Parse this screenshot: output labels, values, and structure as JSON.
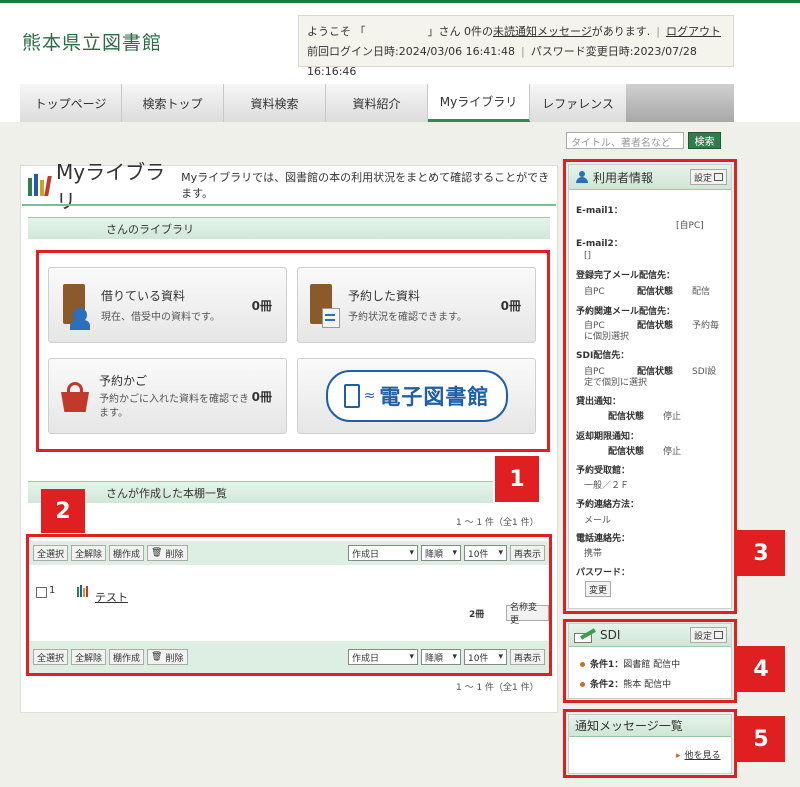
{
  "site": {
    "title": "熊本県立図書館"
  },
  "login": {
    "welcome_pre": "ようこそ 「",
    "welcome_mid": "」さん 0件の",
    "unread_link": "未読通知メッセージ",
    "welcome_post": "があります.",
    "logout": "ログアウト",
    "last_login": "前回ログイン日時:2024/03/06 16:41:48",
    "pw_change": "パスワード変更日時:2023/07/28 16:16:46"
  },
  "nav": {
    "tabs": [
      "トップページ",
      "検索トップ",
      "資料検索",
      "資料紹介",
      "Myライブラリ",
      "レファレンス"
    ],
    "active_index": 4
  },
  "search": {
    "placeholder": "タイトル、著者名など",
    "button": "検索"
  },
  "mylib": {
    "title": "Myライブラリ",
    "desc": "Myライブラリでは、図書館の本の利用状況をまとめて確認することができます。",
    "library_header": "さんのライブラリ",
    "cards": {
      "borrowed": {
        "title": "借りている資料",
        "sub": "現在、借受中の資料です。",
        "count": "0冊"
      },
      "reserved": {
        "title": "予約した資料",
        "sub": "予約状況を確認できます。",
        "count": "0冊"
      },
      "cart": {
        "title": "予約かご",
        "sub": "予約かごに入れた資料を確認できます。",
        "count": "0冊"
      },
      "ebook": {
        "label": "電子図書館"
      }
    },
    "shelf_header": "さんが作成した本棚一覧",
    "pager": "1 ～ 1 件（全1 件）",
    "toolbar": {
      "select_all": "全選択",
      "deselect_all": "全解除",
      "create": "棚作成",
      "delete": "削除",
      "sort": "作成日",
      "order": "降順",
      "per_page": "10件",
      "redisplay": "再表示"
    },
    "shelf_row": {
      "index": "1",
      "name": "テスト",
      "count": "2冊",
      "rename": "名称変更"
    }
  },
  "user_info": {
    "title": "利用者情報",
    "settings": "設定",
    "email1_label": "E-mail1：",
    "email1_val": "[自PC]",
    "email2_label": "E-mail2：",
    "email2_val": "[]",
    "reg_mail_label": "登録完了メール配信先：",
    "reg_mail_c1": "自PC",
    "reg_mail_c2": "配信状態",
    "reg_mail_c3": "配信",
    "res_mail_label": "予約関連メール配信先：",
    "res_mail_c1": "自PC",
    "res_mail_c2": "配信状態",
    "res_mail_c3": "予約毎",
    "res_mail_c4": "に個別選択",
    "sdi_label": "SDI配信先：",
    "sdi_c1": "自PC",
    "sdi_c2": "配信状態",
    "sdi_c3": "SDI設",
    "sdi_c4": "定で個別に選択",
    "loan_label": "貸出通知：",
    "loan_c1": "配信状態",
    "loan_c2": "停止",
    "due_label": "返却期限通知：",
    "due_c1": "配信状態",
    "due_c2": "停止",
    "pickup_label": "予約受取館：",
    "pickup_val": "一般／２Ｆ",
    "contact_label": "予約連絡方法：",
    "contact_val": "メール",
    "phone_label": "電話連絡先：",
    "phone_val": "携帯",
    "pw_label": "パスワード：",
    "pw_btn": "変更"
  },
  "sdi": {
    "title": "SDI",
    "settings": "設定",
    "c1_label": "条件1：",
    "c1_val": "図書館 配信中",
    "c2_label": "条件2：",
    "c2_val": "熊本 配信中"
  },
  "notices": {
    "title": "通知メッセージ一覧",
    "more": "他を見る"
  },
  "badges": [
    "1",
    "2",
    "3",
    "4",
    "5"
  ],
  "colors": {
    "accent": "#2e7d4a",
    "highlight": "#e02020"
  }
}
